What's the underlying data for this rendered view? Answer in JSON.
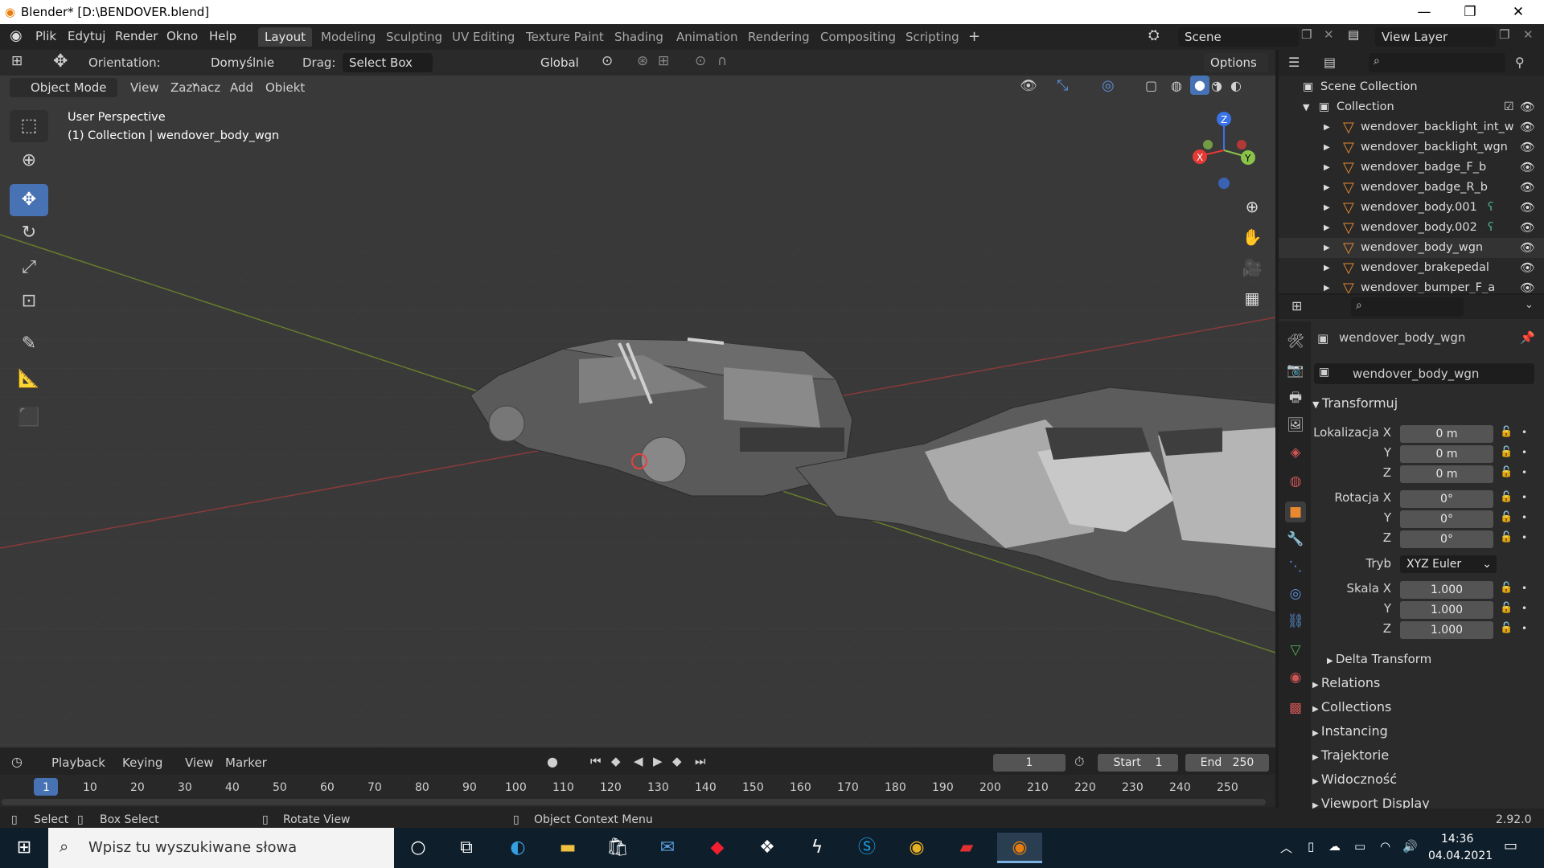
{
  "window": {
    "title": "Blender* [D:\\BENDOVER.blend]"
  },
  "menus": [
    "Plik",
    "Edytuj",
    "Render",
    "Okno",
    "Help"
  ],
  "workspaces": [
    "Layout",
    "Modeling",
    "Sculpting",
    "UV Editing",
    "Texture Paint",
    "Shading",
    "Animation",
    "Rendering",
    "Compositing",
    "Scripting",
    "+"
  ],
  "scene": {
    "name": "Scene",
    "view_layer": "View Layer"
  },
  "toolheader": {
    "orientation_label": "Orientation:",
    "orientation_value": "Domyślnie",
    "drag_label": "Drag:",
    "drag_value": "Select Box",
    "transform_orientation": "Global",
    "options": "Options"
  },
  "viewport_header": {
    "mode": "Object Mode",
    "menu": [
      "View",
      "Zaznacz",
      "Add",
      "Obiekt"
    ]
  },
  "viewport_info": {
    "line1": "User Perspective",
    "line2": "(1) Collection | wendover_body_wgn"
  },
  "gizmo": {
    "x": "X",
    "y": "Y",
    "z": "Z"
  },
  "outliner": {
    "root": "Scene Collection",
    "collection": "Collection",
    "items": [
      "wendover_backlight_int_w",
      "wendover_backlight_wgn",
      "wendover_badge_F_b",
      "wendover_badge_R_b",
      "wendover_body.001",
      "wendover_body.002",
      "wendover_body_wgn",
      "wendover_brakepedal",
      "wendover_bumper_F_a"
    ]
  },
  "properties": {
    "object_name": "wendover_body_wgn",
    "object_field": "wendover_body_wgn",
    "transform_title": "Transformuj",
    "location_label": "Lokalizacja X",
    "rotation_label": "Rotacja X",
    "scale_label": "Skala X",
    "axis_y": "Y",
    "axis_z": "Z",
    "loc": [
      "0 m",
      "0 m",
      "0 m"
    ],
    "rot": [
      "0°",
      "0°",
      "0°"
    ],
    "mode_label": "Tryb",
    "mode_value": "XYZ Euler",
    "scale": [
      "1.000",
      "1.000",
      "1.000"
    ],
    "delta": "Delta Transform",
    "panels": [
      "Relations",
      "Collections",
      "Instancing",
      "Trajektorie",
      "Widoczność",
      "Viewport Display"
    ]
  },
  "timeline": {
    "menu": [
      "Playback",
      "Keying",
      "View",
      "Marker"
    ],
    "current_frame": "1",
    "start_label": "Start",
    "start": "1",
    "end_label": "End",
    "end": "250",
    "ruler": [
      "1",
      "10",
      "20",
      "30",
      "40",
      "50",
      "60",
      "70",
      "80",
      "90",
      "100",
      "110",
      "120",
      "130",
      "140",
      "150",
      "160",
      "170",
      "180",
      "190",
      "200",
      "210",
      "220",
      "230",
      "240",
      "250"
    ]
  },
  "status": {
    "select": "Select",
    "box_select": "Box Select",
    "rotate": "Rotate View",
    "context": "Object Context Menu",
    "version": "2.92.0"
  },
  "taskbar": {
    "search_placeholder": "Wpisz tu wyszukiwane słowa",
    "time": "14:36",
    "date": "04.04.2021"
  }
}
